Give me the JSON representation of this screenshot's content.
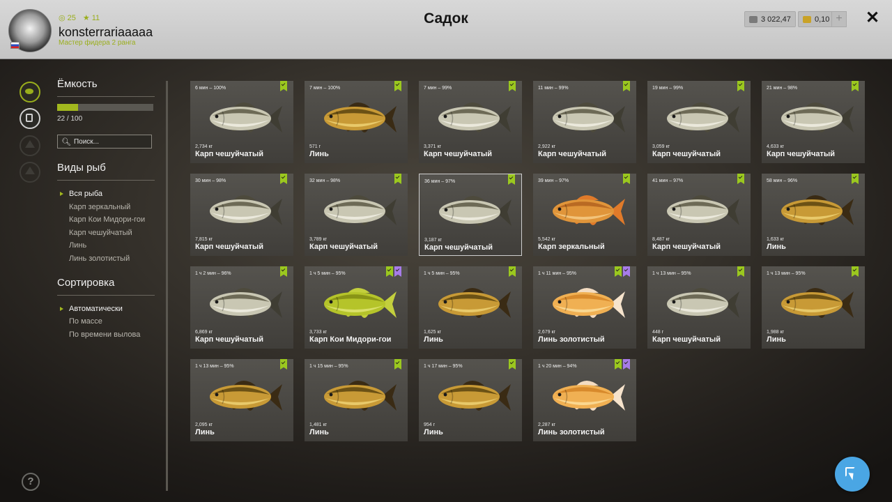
{
  "header": {
    "title": "Садок",
    "username": "konsterrariaaaaa",
    "rank": "Мастер фидера 2 ранга",
    "level": "25",
    "stars": "11",
    "silver": "3 022,47",
    "gold": "0,10",
    "plus_label": "+",
    "close_label": "✕"
  },
  "sidebar": {
    "capacity_title": "Ёмкость",
    "capacity_value": 22,
    "capacity_max": 100,
    "capacity_text": "22 / 100",
    "search_placeholder": "Поиск...",
    "species_title": "Виды рыб",
    "species": [
      "Вся рыба",
      "Карп зеркальный",
      "Карп Кои Мидори-гои",
      "Карп чешуйчатый",
      "Линь",
      "Линь золотистый"
    ],
    "species_active": 0,
    "sort_title": "Сортировка",
    "sort": [
      "Автоматически",
      "По массе",
      "По времени вылова"
    ],
    "sort_active": 0
  },
  "help_label": "?",
  "colors": {
    "accent": "#9aae1c",
    "badge_green": "#9bc81f",
    "badge_purple": "#a77ce9",
    "fab": "#4aa6e4"
  },
  "fish": [
    {
      "time": "6 мин – 100%",
      "weight": "2,734 кг",
      "name": "Карп чешуйчатый",
      "kind": "carp",
      "badges": [
        "green"
      ]
    },
    {
      "time": "7 мин – 100%",
      "weight": "571 г",
      "name": "Линь",
      "kind": "tench",
      "badges": [
        "green"
      ]
    },
    {
      "time": "7 мин – 99%",
      "weight": "3,371 кг",
      "name": "Карп чешуйчатый",
      "kind": "carp",
      "badges": [
        "green"
      ]
    },
    {
      "time": "11 мин – 99%",
      "weight": "2,922 кг",
      "name": "Карп чешуйчатый",
      "kind": "carp",
      "badges": [
        "green"
      ]
    },
    {
      "time": "19 мин – 99%",
      "weight": "3,059 кг",
      "name": "Карп чешуйчатый",
      "kind": "carp",
      "badges": [
        "green"
      ]
    },
    {
      "time": "21 мин – 98%",
      "weight": "4,633 кг",
      "name": "Карп чешуйчатый",
      "kind": "carp",
      "badges": [
        "green"
      ]
    },
    {
      "time": "30 мин – 98%",
      "weight": "7,815 кг",
      "name": "Карп чешуйчатый",
      "kind": "carp",
      "badges": [
        "green"
      ]
    },
    {
      "time": "32 мин – 98%",
      "weight": "3,789 кг",
      "name": "Карп чешуйчатый",
      "kind": "carp",
      "badges": [
        "green"
      ]
    },
    {
      "time": "36 мин – 97%",
      "weight": "3,187 кг",
      "name": "Карп чешуйчатый",
      "kind": "carp",
      "badges": [
        "green"
      ],
      "selected": true
    },
    {
      "time": "39 мин – 97%",
      "weight": "5,542 кг",
      "name": "Карп зеркальный",
      "kind": "mirror",
      "badges": [
        "green"
      ]
    },
    {
      "time": "41 мин – 97%",
      "weight": "8,487 кг",
      "name": "Карп чешуйчатый",
      "kind": "carp",
      "badges": [
        "green"
      ]
    },
    {
      "time": "58 мин – 96%",
      "weight": "1,633 кг",
      "name": "Линь",
      "kind": "tench",
      "badges": [
        "green"
      ]
    },
    {
      "time": "1 ч 2 мин – 96%",
      "weight": "6,869 кг",
      "name": "Карп чешуйчатый",
      "kind": "carp",
      "badges": [
        "green"
      ]
    },
    {
      "time": "1 ч 5 мин – 95%",
      "weight": "3,733 кг",
      "name": "Карп Кои Мидори-гои",
      "kind": "koi",
      "badges": [
        "green",
        "purple"
      ]
    },
    {
      "time": "1 ч 5 мин – 95%",
      "weight": "1,625 кг",
      "name": "Линь",
      "kind": "tench",
      "badges": [
        "green"
      ]
    },
    {
      "time": "1 ч 11 мин – 95%",
      "weight": "2,679 кг",
      "name": "Линь золотистый",
      "kind": "golden",
      "badges": [
        "green",
        "purple"
      ]
    },
    {
      "time": "1 ч 13 мин – 95%",
      "weight": "448 г",
      "name": "Карп чешуйчатый",
      "kind": "carp",
      "badges": [
        "green"
      ]
    },
    {
      "time": "1 ч 13 мин – 95%",
      "weight": "1,988 кг",
      "name": "Линь",
      "kind": "tench",
      "badges": [
        "green"
      ]
    },
    {
      "time": "1 ч 13 мин – 95%",
      "weight": "2,095 кг",
      "name": "Линь",
      "kind": "tench",
      "badges": [
        "green"
      ]
    },
    {
      "time": "1 ч 15 мин – 95%",
      "weight": "1,481 кг",
      "name": "Линь",
      "kind": "tench",
      "badges": [
        "green"
      ]
    },
    {
      "time": "1 ч 17 мин – 95%",
      "weight": "954 г",
      "name": "Линь",
      "kind": "tench",
      "badges": [
        "green"
      ]
    },
    {
      "time": "1 ч 20 мин – 94%",
      "weight": "2,287 кг",
      "name": "Линь золотистый",
      "kind": "golden",
      "badges": [
        "green",
        "purple"
      ]
    }
  ]
}
